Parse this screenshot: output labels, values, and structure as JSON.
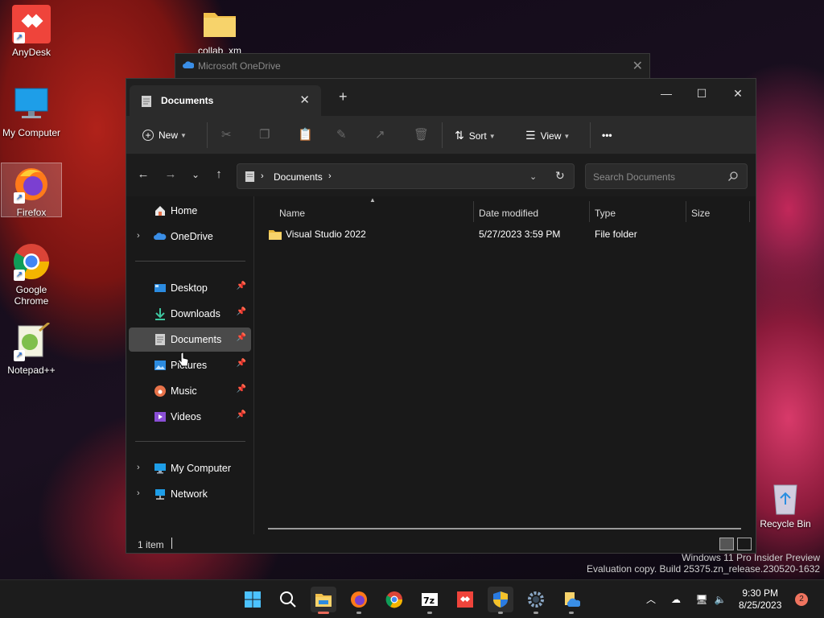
{
  "desktop": {
    "icons": [
      {
        "label": "AnyDesk"
      },
      {
        "label": "collab_xm"
      },
      {
        "label": "My Computer"
      },
      {
        "label": "Firefox"
      },
      {
        "label": "Google Chrome"
      },
      {
        "label": "Notepad++"
      },
      {
        "label": "Recycle Bin"
      }
    ]
  },
  "background_window": {
    "title": "Microsoft OneDrive"
  },
  "explorer": {
    "tab_title": "Documents",
    "new_tab_symbol": "+",
    "toolbar": {
      "new_label": "New",
      "sort_label": "Sort",
      "view_label": "View",
      "more_label": "•••"
    },
    "address": {
      "crumb": "Documents"
    },
    "search": {
      "placeholder": "Search Documents"
    },
    "nav": {
      "home": "Home",
      "onedrive": "OneDrive",
      "desktop": "Desktop",
      "downloads": "Downloads",
      "documents": "Documents",
      "pictures": "Pictures",
      "music": "Music",
      "videos": "Videos",
      "my_computer": "My Computer",
      "network": "Network"
    },
    "columns": [
      "Name",
      "Date modified",
      "Type",
      "Size"
    ],
    "rows": [
      {
        "name": "Visual Studio 2022",
        "date": "5/27/2023 3:59 PM",
        "type": "File folder",
        "size": ""
      }
    ],
    "status": {
      "item_count": "1 item"
    }
  },
  "watermark": {
    "line1": "Windows 11 Pro Insider Preview",
    "line2": "Evaluation copy. Build 25375.zn_release.230520-1632"
  },
  "taskbar": {
    "time": "9:30 PM",
    "date": "8/25/2023",
    "notification_count": "2"
  },
  "colors": {
    "accent": "#0078d4",
    "folder": "#f2c04b",
    "window_bg": "#191919",
    "toolbar_bg": "#2b2b2b",
    "selection": "#4a4a4a"
  }
}
